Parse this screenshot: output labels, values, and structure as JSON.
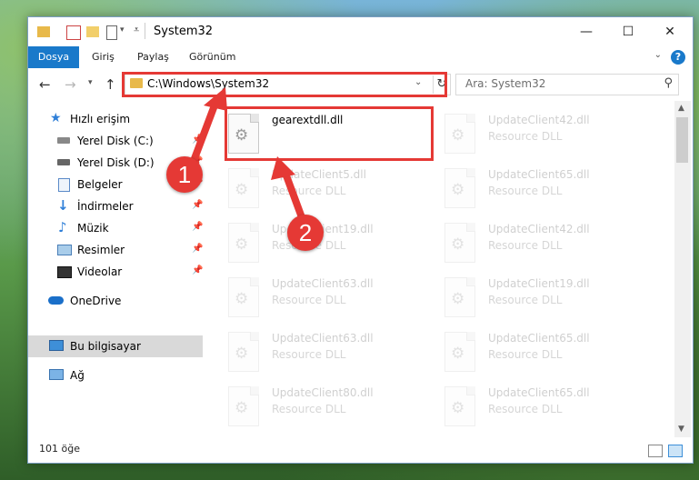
{
  "window": {
    "title": "System32"
  },
  "ribbon": {
    "tabs": [
      "Dosya",
      "Giriş",
      "Paylaş",
      "Görünüm"
    ],
    "help": "?"
  },
  "address": {
    "path": "C:\\Windows\\System32",
    "search_placeholder": "Ara: System32"
  },
  "sidebar": {
    "items": [
      {
        "label": "Hızlı erişim",
        "icon": "star-icon"
      },
      {
        "label": "Yerel Disk (C:)",
        "icon": "drive-icon"
      },
      {
        "label": "Yerel Disk (D:)",
        "icon": "drive-icon"
      },
      {
        "label": "Belgeler",
        "icon": "documents-icon"
      },
      {
        "label": "İndirmeler",
        "icon": "download-icon"
      },
      {
        "label": "Müzik",
        "icon": "music-icon"
      },
      {
        "label": "Resimler",
        "icon": "pictures-icon"
      },
      {
        "label": "Videolar",
        "icon": "video-icon"
      },
      {
        "label": "OneDrive",
        "icon": "cloud-icon"
      },
      {
        "label": "Bu bilgisayar",
        "icon": "computer-icon"
      },
      {
        "label": "Ağ",
        "icon": "network-icon"
      }
    ]
  },
  "files": [
    {
      "name": "gearextdll.dll",
      "type": ""
    },
    {
      "name": "UpdateClient42.dll",
      "type": "Resource DLL"
    },
    {
      "name": "UpdateClient5.dll",
      "type": "Resource DLL"
    },
    {
      "name": "UpdateClient65.dll",
      "type": "Resource DLL"
    },
    {
      "name": "UpdateClient19.dll",
      "type": "Resource DLL"
    },
    {
      "name": "UpdateClient42.dll",
      "type": "Resource DLL"
    },
    {
      "name": "UpdateClient63.dll",
      "type": "Resource DLL"
    },
    {
      "name": "UpdateClient19.dll",
      "type": "Resource DLL"
    },
    {
      "name": "UpdateClient63.dll",
      "type": "Resource DLL"
    },
    {
      "name": "UpdateClient65.dll",
      "type": "Resource DLL"
    },
    {
      "name": "UpdateClient80.dll",
      "type": "Resource DLL"
    },
    {
      "name": "UpdateClient65.dll",
      "type": "Resource DLL"
    }
  ],
  "status": {
    "count": "101 öğe"
  },
  "annotations": {
    "badge1": "1",
    "badge2": "2",
    "color": "#e53935"
  },
  "colors": {
    "accent": "#1979ca",
    "selection": "#d9d9d9"
  }
}
